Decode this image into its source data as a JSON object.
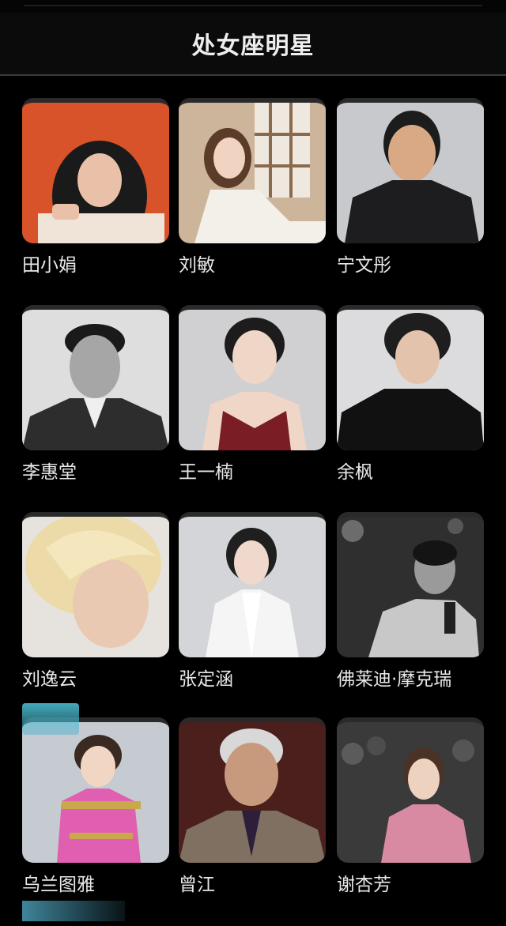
{
  "header": {
    "title": "处女座明星"
  },
  "celebrities": [
    {
      "name": "田小娟",
      "icon": "woman-portrait",
      "bg": "#d9532a"
    },
    {
      "name": "刘敏",
      "icon": "woman-portrait",
      "bg": "#c9a98c"
    },
    {
      "name": "宁文彤",
      "icon": "man-portrait",
      "bg": "#c4c6ca"
    },
    {
      "name": "李惠堂",
      "icon": "man-portrait",
      "bg": "#d8d8d8"
    },
    {
      "name": "王一楠",
      "icon": "woman-portrait",
      "bg": "#cdcdd0"
    },
    {
      "name": "余枫",
      "icon": "man-portrait",
      "bg": "#d9dadc"
    },
    {
      "name": "刘逸云",
      "icon": "woman-portrait",
      "bg": "#e3e0dc"
    },
    {
      "name": "张定涵",
      "icon": "woman-portrait",
      "bg": "#d3d4d6"
    },
    {
      "name": "佛莱迪·摩克瑞",
      "icon": "man-portrait",
      "bg": "#3a3a3a"
    },
    {
      "name": "乌兰图雅",
      "icon": "woman-portrait",
      "bg": "#c4c8cf"
    },
    {
      "name": "曾江",
      "icon": "man-portrait",
      "bg": "#4a1f1c"
    },
    {
      "name": "谢杏芳",
      "icon": "woman-portrait",
      "bg": "#3b3b3b"
    }
  ]
}
